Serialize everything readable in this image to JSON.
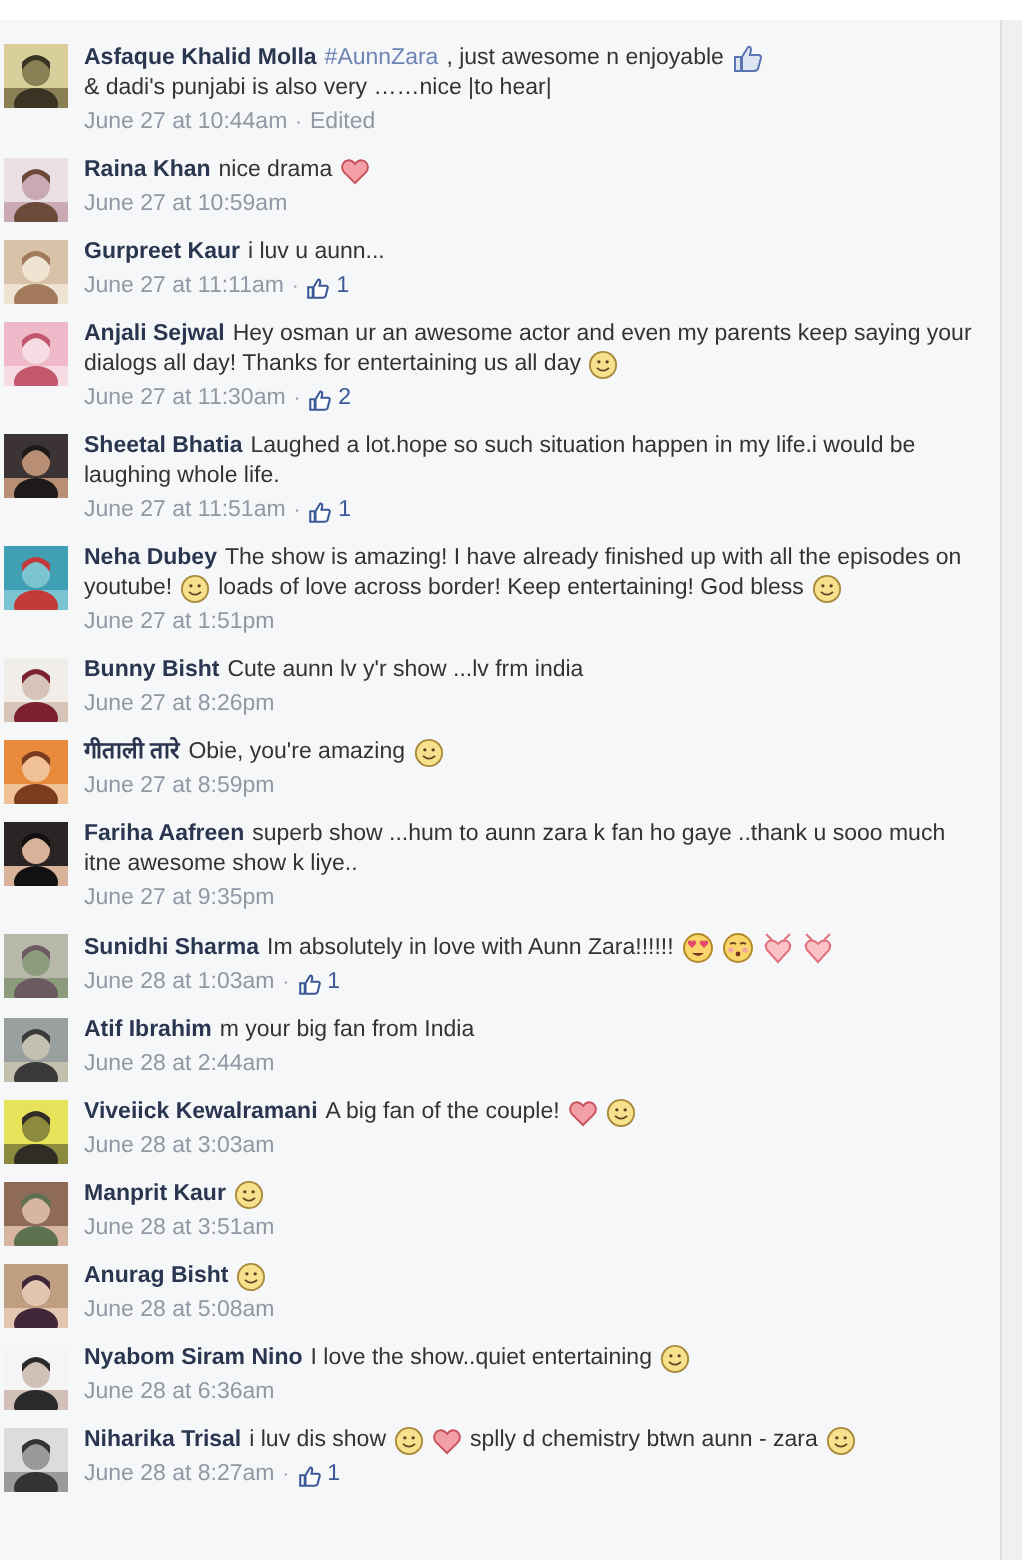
{
  "comments": [
    {
      "name": "Asfaque Khalid Molla",
      "body": [
        {
          "kind": "hashtag",
          "text": "#AunnZara"
        },
        {
          "kind": "text",
          "text": ", just awesome n enjoyable"
        },
        {
          "kind": "like"
        },
        {
          "kind": "break"
        },
        {
          "kind": "text",
          "text": "& dadi's punjabi is also very ……nice |to hear|"
        }
      ],
      "meta": [
        {
          "kind": "time",
          "text": "June 27 at 10:44am"
        },
        {
          "kind": "dot",
          "text": "·"
        },
        {
          "kind": "edited",
          "text": "Edited"
        }
      ]
    },
    {
      "name": "Raina Khan",
      "body": [
        {
          "kind": "text",
          "text": "nice drama"
        },
        {
          "kind": "heart"
        }
      ],
      "meta": [
        {
          "kind": "time",
          "text": "June 27 at 10:59am"
        }
      ]
    },
    {
      "name": "Gurpreet Kaur",
      "body": [
        {
          "kind": "text",
          "text": "i luv u aunn..."
        }
      ],
      "meta": [
        {
          "kind": "time",
          "text": "June 27 at 11:11am"
        },
        {
          "kind": "dot",
          "text": "·"
        },
        {
          "kind": "like"
        },
        {
          "kind": "count",
          "text": "1"
        }
      ]
    },
    {
      "name": "Anjali Sejwal",
      "body": [
        {
          "kind": "text",
          "text": "Hey osman ur an awesome actor and even my parents keep saying your"
        },
        {
          "kind": "break"
        },
        {
          "kind": "text",
          "text": "dialogs all day! Thanks for entertaining us all day"
        },
        {
          "kind": "smile"
        }
      ],
      "meta": [
        {
          "kind": "time",
          "text": "June 27 at 11:30am"
        },
        {
          "kind": "dot",
          "text": "·"
        },
        {
          "kind": "like"
        },
        {
          "kind": "count",
          "text": "2"
        }
      ]
    },
    {
      "name": "Sheetal Bhatia",
      "body": [
        {
          "kind": "text",
          "text": "Laughed a lot.hope so such situation happen in my life.i would be"
        },
        {
          "kind": "break"
        },
        {
          "kind": "text",
          "text": "laughing whole life."
        }
      ],
      "meta": [
        {
          "kind": "time",
          "text": "June 27 at 11:51am"
        },
        {
          "kind": "dot",
          "text": "·"
        },
        {
          "kind": "like"
        },
        {
          "kind": "count",
          "text": "1"
        }
      ]
    },
    {
      "name": "Neha Dubey",
      "body": [
        {
          "kind": "text",
          "text": "The show is amazing! I have already finished up with all the episodes on"
        },
        {
          "kind": "break"
        },
        {
          "kind": "text",
          "text": "youtube!"
        },
        {
          "kind": "smile"
        },
        {
          "kind": "text",
          "text": "loads of love across border! Keep entertaining! God bless"
        },
        {
          "kind": "smile"
        }
      ],
      "meta": [
        {
          "kind": "time",
          "text": "June 27 at 1:51pm"
        }
      ]
    },
    {
      "name": "Bunny Bisht",
      "body": [
        {
          "kind": "text",
          "text": "Cute aunn lv y'r show ...lv frm india"
        }
      ],
      "meta": [
        {
          "kind": "time",
          "text": "June 27 at 8:26pm"
        }
      ]
    },
    {
      "name": "गीताली तारे",
      "body": [
        {
          "kind": "text",
          "text": "Obie, you're amazing"
        },
        {
          "kind": "smile"
        }
      ],
      "meta": [
        {
          "kind": "time",
          "text": "June 27 at 8:59pm"
        }
      ]
    },
    {
      "name": "Fariha Aafreen",
      "body": [
        {
          "kind": "text",
          "text": "superb show ...hum to aunn zara k fan ho gaye ..thank u sooo much"
        },
        {
          "kind": "break"
        },
        {
          "kind": "text",
          "text": "itne awesome show k liye.."
        }
      ],
      "meta": [
        {
          "kind": "time",
          "text": "June 27 at 9:35pm"
        }
      ]
    },
    {
      "name": "Sunidhi Sharma",
      "body": [
        {
          "kind": "text",
          "text": "Im absolutely in love with Aunn Zara!!!!!!"
        },
        {
          "kind": "heart-eyes"
        },
        {
          "kind": "kiss"
        },
        {
          "kind": "heart-bow"
        },
        {
          "kind": "heart-bow"
        }
      ],
      "meta": [
        {
          "kind": "time",
          "text": "June 28 at 1:03am"
        },
        {
          "kind": "dot",
          "text": "·"
        },
        {
          "kind": "like"
        },
        {
          "kind": "count",
          "text": "1"
        }
      ]
    },
    {
      "name": "Atif Ibrahim",
      "body": [
        {
          "kind": "text",
          "text": "m your big fan from India"
        }
      ],
      "meta": [
        {
          "kind": "time",
          "text": "June 28 at 2:44am"
        }
      ]
    },
    {
      "name": "Viveiick Kewalramani",
      "body": [
        {
          "kind": "text",
          "text": "A big fan of the couple!"
        },
        {
          "kind": "heart"
        },
        {
          "kind": "smile"
        }
      ],
      "meta": [
        {
          "kind": "time",
          "text": "June 28 at 3:03am"
        }
      ]
    },
    {
      "name": "Manprit Kaur",
      "body": [
        {
          "kind": "smile"
        }
      ],
      "meta": [
        {
          "kind": "time",
          "text": "June 28 at 3:51am"
        }
      ]
    },
    {
      "name": "Anurag Bisht",
      "body": [
        {
          "kind": "smile"
        }
      ],
      "meta": [
        {
          "kind": "time",
          "text": "June 28 at 5:08am"
        }
      ]
    },
    {
      "name": "Nyabom Siram Nino",
      "body": [
        {
          "kind": "text",
          "text": "I love the show..quiet entertaining"
        },
        {
          "kind": "smile"
        }
      ],
      "meta": [
        {
          "kind": "time",
          "text": "June 28 at 6:36am"
        }
      ]
    },
    {
      "name": "Niharika Trisal",
      "body": [
        {
          "kind": "text",
          "text": "i luv dis show"
        },
        {
          "kind": "smile"
        },
        {
          "kind": "heart"
        },
        {
          "kind": "text",
          "text": "splly d chemistry btwn aunn - zara"
        },
        {
          "kind": "smile"
        }
      ],
      "meta": [
        {
          "kind": "time",
          "text": "June 28 at 8:27am"
        },
        {
          "kind": "dot",
          "text": "·"
        },
        {
          "kind": "like"
        },
        {
          "kind": "count",
          "text": "1"
        }
      ]
    }
  ]
}
